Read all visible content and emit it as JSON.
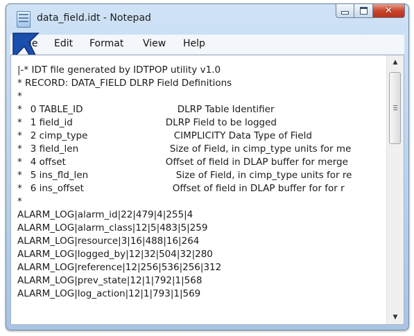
{
  "window": {
    "title": "data_field.idt - Notepad",
    "icon": "notepad-icon",
    "controls": {
      "minimize": "minimize-icon",
      "maximize": "maximize-icon",
      "close": "✕"
    }
  },
  "menu": {
    "items": [
      "File",
      "Edit",
      "Format",
      "View",
      "Help"
    ]
  },
  "editor": {
    "header_lines": [
      "|-* IDT file generated by IDTPOP utility v1.0",
      "* RECORD: DATA_FIELD DLRP Field Definitions",
      "*"
    ],
    "columns": [
      {
        "star": "*",
        "name": "0 TABLE_ID",
        "desc": "DLRP Table Identifier"
      },
      {
        "star": "*",
        "name": "1 field_id",
        "desc": "DLRP Field to be logged"
      },
      {
        "star": "*",
        "name": "2 cimp_type",
        "desc": "CIMPLICITY Data Type of Field"
      },
      {
        "star": "*",
        "name": "3 field_len",
        "desc": "Size of Field, in cimp_type units for me"
      },
      {
        "star": "*",
        "name": "4 offset",
        "desc": "Offset of field in DLAP buffer for merge"
      },
      {
        "star": "*",
        "name": "5 ins_fld_len",
        "desc": "Size of Field, in cimp_type units for re"
      },
      {
        "star": "*",
        "name": "6 ins_offset",
        "desc": "Offset of field in DLAP buffer for for r"
      }
    ],
    "separator": "*",
    "records": [
      "ALARM_LOG|alarm_id|22|479|4|255|4",
      "ALARM_LOG|alarm_class|12|5|483|5|259",
      "ALARM_LOG|resource|3|16|488|16|264",
      "ALARM_LOG|logged_by|12|32|504|32|280",
      "ALARM_LOG|reference|12|256|536|256|312",
      "ALARM_LOG|prev_state|12|1|792|1|568",
      "ALARM_LOG|log_action|12|1|793|1|569"
    ],
    "scrollbar": {
      "up_arrow": "▲",
      "down_arrow": "▼"
    }
  }
}
